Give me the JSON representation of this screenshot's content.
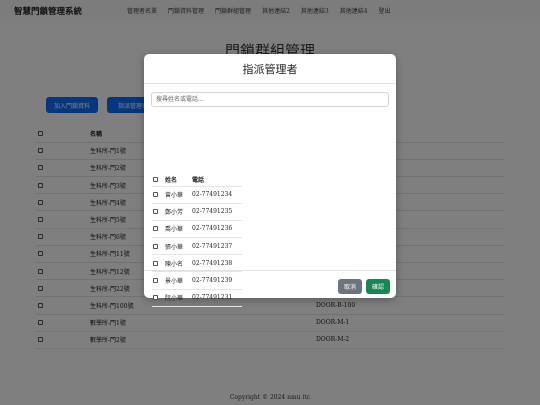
{
  "navbar": {
    "brand": "智慧門鎖管理系統",
    "items": [
      "管理者名單",
      "門鎖資料管理",
      "門鎖群組管理",
      "其他連結2",
      "其他連結3",
      "其他連結4",
      "登出"
    ]
  },
  "page": {
    "title": "門鎖群組管理",
    "add_button": "加入門鎖資料",
    "assign_button": "指派管理者"
  },
  "table": {
    "header_name": "名稱",
    "rows": [
      {
        "name": "生科所-門1號",
        "code": ""
      },
      {
        "name": "生科所-門2號",
        "code": ""
      },
      {
        "name": "生科所-門3號",
        "code": ""
      },
      {
        "name": "生科所-門4號",
        "code": ""
      },
      {
        "name": "生科所-門5號",
        "code": ""
      },
      {
        "name": "生科所-門6號",
        "code": ""
      },
      {
        "name": "生科所-門11號",
        "code": ""
      },
      {
        "name": "生科所-門12號",
        "code": ""
      },
      {
        "name": "生科所-門22號",
        "code": ""
      },
      {
        "name": "生科所-門100號",
        "code": "DOOR-B-100"
      },
      {
        "name": "數學所-門1號",
        "code": "DOOR-M-1"
      },
      {
        "name": "數學所-門2號",
        "code": "DOOR-M-2"
      }
    ]
  },
  "footer": {
    "copyright": "Copyright © 2024 nmu itc"
  },
  "modal": {
    "title": "指派管理者",
    "search_placeholder": "搜尋姓名或電話...",
    "col_name": "姓名",
    "col_phone": "電話",
    "managers": [
      {
        "name": "曾小華",
        "phone": "02-77491234"
      },
      {
        "name": "鄭小芳",
        "phone": "02-77491235"
      },
      {
        "name": "喬小華",
        "phone": "02-77491236"
      },
      {
        "name": "張小華",
        "phone": "02-77491237"
      },
      {
        "name": "陳小名",
        "phone": "02-77491238"
      },
      {
        "name": "景小華",
        "phone": "02-77491239"
      },
      {
        "name": "阮小華",
        "phone": "02-77491231"
      },
      {
        "name": "",
        "phone": ""
      }
    ],
    "cancel_label": "取消",
    "confirm_label": "確認"
  },
  "colors": {
    "primary": "#0d6efd",
    "secondary": "#6c757d",
    "success": "#198754"
  }
}
